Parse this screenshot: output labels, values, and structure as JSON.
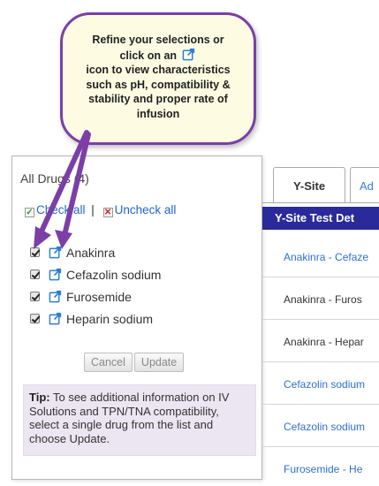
{
  "callout": {
    "line1": "Refine your selections or",
    "line2_before": "click on an",
    "line3": "icon to view characteristics",
    "line4": "such as pH, compatibility &",
    "line5": "stability and proper rate of",
    "line6": "infusion"
  },
  "drug_panel": {
    "title": "All Drugs (4)",
    "check_all": "Check all",
    "separator": "|",
    "uncheck_all": "Uncheck all",
    "drugs": [
      {
        "name": "Anakinra",
        "checked": true
      },
      {
        "name": "Cefazolin sodium",
        "checked": true
      },
      {
        "name": "Furosemide",
        "checked": true
      },
      {
        "name": "Heparin sodium",
        "checked": true
      }
    ],
    "cancel_label": "Cancel",
    "update_label": "Update",
    "tip_label": "Tip:",
    "tip_text": "To see additional information on IV Solutions and TPN/TNA compatibility, select a single drug from the list and choose Update."
  },
  "tabs": {
    "active": "Y-Site",
    "next": "Ad"
  },
  "results": {
    "header": "Y-Site Test Det",
    "rows": [
      {
        "text": "Anakinra - Cefaze",
        "style": "link"
      },
      {
        "text": "Anakinra - Furos",
        "style": "plain"
      },
      {
        "text": "Anakinra - Hepar",
        "style": "plain"
      },
      {
        "text": "Cefazolin sodium",
        "style": "link"
      },
      {
        "text": "Cefazolin sodium",
        "style": "link"
      },
      {
        "text": "Furosemide - He",
        "style": "link"
      }
    ]
  },
  "colors": {
    "callout_border": "#7b3fa6",
    "callout_fill": "#fdfce3",
    "arrow": "#7b3fa6",
    "header_bg": "#2a2a9a",
    "link": "#2f6fcc",
    "tip_bg": "#ece6f3",
    "icon_blue": "#2b7fd6"
  },
  "icons": {
    "external_link": "external-link-icon"
  }
}
